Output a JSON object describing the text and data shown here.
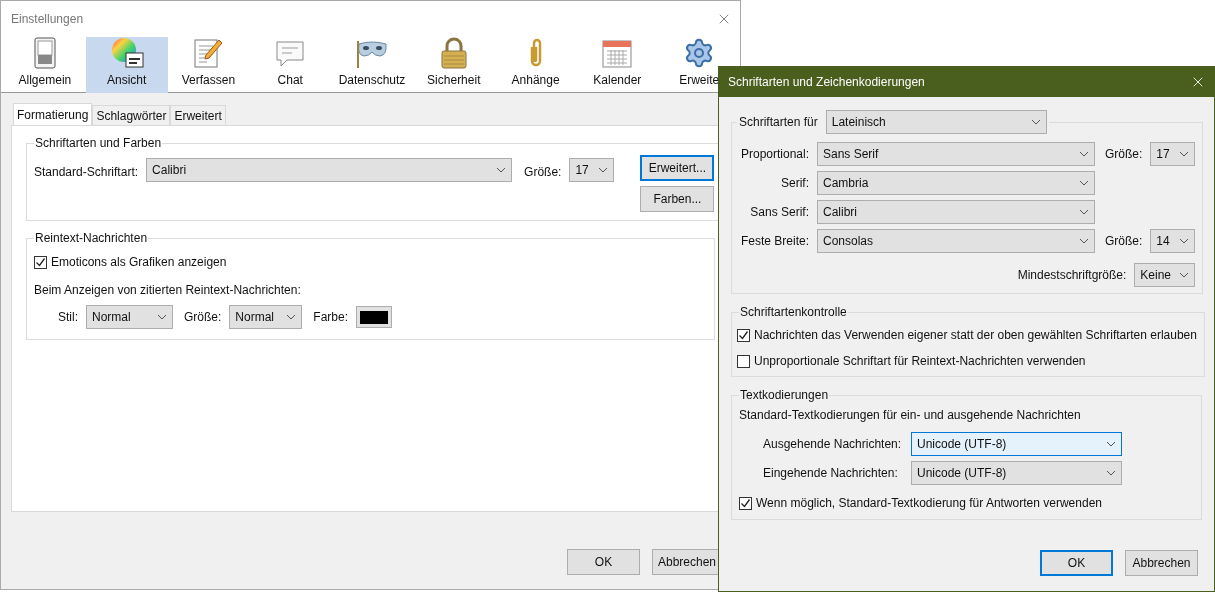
{
  "main_window": {
    "title": "Einstellungen",
    "toolbar": [
      {
        "label": "Allgemein",
        "selected": false
      },
      {
        "label": "Ansicht",
        "selected": true
      },
      {
        "label": "Verfassen",
        "selected": false
      },
      {
        "label": "Chat",
        "selected": false
      },
      {
        "label": "Datenschutz",
        "selected": false
      },
      {
        "label": "Sicherheit",
        "selected": false
      },
      {
        "label": "Anhänge",
        "selected": false
      },
      {
        "label": "Kalender",
        "selected": false
      },
      {
        "label": "Erweite",
        "selected": false
      }
    ],
    "tabs": [
      {
        "label": "Formatierung",
        "selected": true
      },
      {
        "label": "Schlagwörter",
        "selected": false
      },
      {
        "label": "Erweitert",
        "selected": false
      }
    ],
    "fonts_group": {
      "title": "Schriftarten und Farben",
      "font_label": "Standard-Schriftart:",
      "font_value": "Calibri",
      "size_label": "Größe:",
      "size_value": "17",
      "buttons": [
        {
          "label": "Erweitert...",
          "focused": true
        },
        {
          "label": "Farben...",
          "focused": false
        }
      ]
    },
    "plaintext_group": {
      "title": "Reintext-Nachrichten",
      "checkbox": {
        "label": "Emoticons als Grafiken anzeigen",
        "checked": true
      },
      "quote_label": "Beim Anzeigen von zitierten Reintext-Nachrichten:",
      "style_label": "Stil:",
      "style_value": "Normal",
      "size_label": "Größe:",
      "size_value": "Normal",
      "color_label": "Farbe:",
      "color": "#000000"
    },
    "buttons": [
      {
        "label": "OK",
        "focused": false
      },
      {
        "label": "Abbrechen",
        "focused": false
      }
    ]
  },
  "dialog": {
    "title": "Schriftarten und Zeichenkodierungen",
    "script_label": "Schriftarten für",
    "script_value": "Lateinisch",
    "rows": [
      {
        "label": "Proportional:",
        "value": "Sans Serif",
        "size_label": "Größe:",
        "size_value": "17"
      },
      {
        "label": "Serif:",
        "value": "Cambria"
      },
      {
        "label": "Sans Serif:",
        "value": "Calibri"
      },
      {
        "label": "Feste Breite:",
        "value": "Consolas",
        "size_label": "Größe:",
        "size_value": "14"
      }
    ],
    "min_size_label": "Mindestschriftgröße:",
    "min_size_value": "Keine",
    "control_group": {
      "title": "Schriftartenkontrolle",
      "checkboxes": [
        {
          "label": "Nachrichten das Verwenden eigener statt der oben gewählten Schriftarten erlauben",
          "checked": true
        },
        {
          "label": "Unproportionale Schriftart für Reintext-Nachrichten verwenden",
          "checked": false
        }
      ]
    },
    "encoding_group": {
      "title": "Textkodierungen",
      "description": "Standard-Textkodierungen für ein- und ausgehende Nachrichten",
      "rows": [
        {
          "label": "Ausgehende Nachrichten:",
          "value": "Unicode (UTF-8)",
          "focused": true
        },
        {
          "label": "Eingehende Nachrichten:",
          "value": "Unicode (UTF-8)",
          "focused": false
        }
      ],
      "checkbox": {
        "label": "Wenn möglich, Standard-Textkodierung für Antworten verwenden",
        "checked": true
      }
    },
    "buttons": [
      {
        "label": "OK",
        "focused": true
      },
      {
        "label": "Abbrechen",
        "focused": false
      }
    ]
  }
}
